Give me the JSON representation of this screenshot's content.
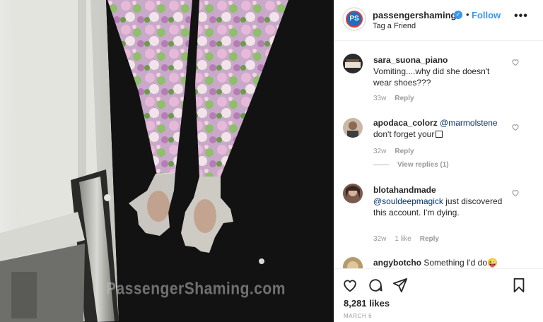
{
  "photo": {
    "watermark": "PassengerShaming.com"
  },
  "header": {
    "avatar_text": "PS",
    "username": "passengershaming",
    "verified_icon": "verified-badge-icon",
    "separator": "•",
    "follow_label": "Follow",
    "subtitle": "Tag a Friend",
    "more_label": "•••"
  },
  "comments": [
    {
      "username": "sara_suona_piano",
      "text": "Vomiting....why did she doesn't wear shoes???",
      "time": "33w",
      "reply_label": "Reply"
    },
    {
      "username": "apodaca_colorz",
      "mention": "@marmolstene",
      "text": "don't forget your",
      "time": "32w",
      "reply_label": "Reply",
      "view_replies": "View replies (1)"
    },
    {
      "username": "blotahandmade",
      "mention": "@souldeepmagick",
      "text": "just discovered this account. I'm dying.",
      "time": "32w",
      "likes": "1 like",
      "reply_label": "Reply"
    },
    {
      "username": "angybotcho",
      "text": "Something I'd do",
      "emoji": "😜"
    }
  ],
  "actions": {
    "like_icon": "heart-icon",
    "comment_icon": "comment-icon",
    "share_icon": "send-icon",
    "save_icon": "bookmark-icon",
    "likes": "8,281 likes",
    "date": "MARCH 6"
  },
  "colors": {
    "link_blue": "#3897f0",
    "mention_blue": "#003569",
    "meta_gray": "#999999"
  }
}
